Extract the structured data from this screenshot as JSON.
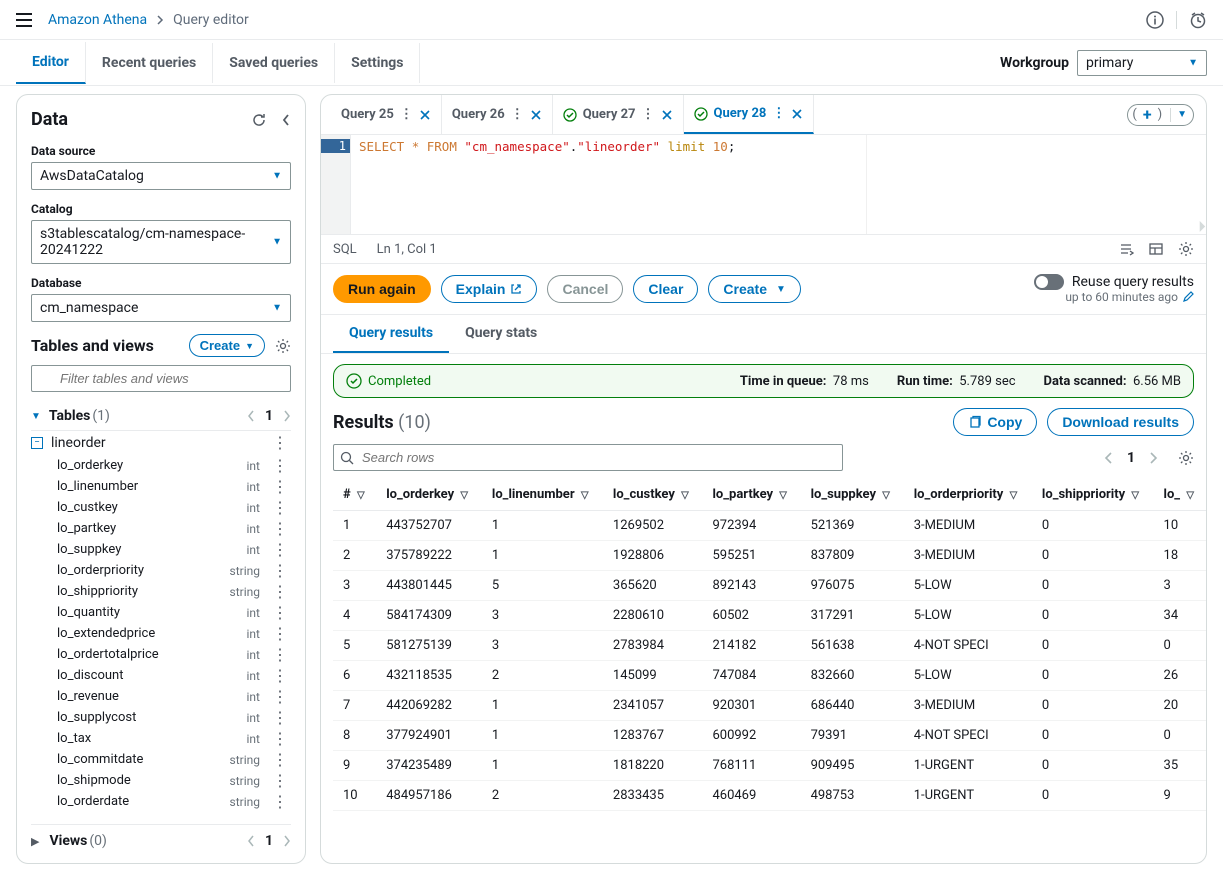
{
  "breadcrumb": {
    "service": "Amazon Athena",
    "page": "Query editor"
  },
  "topnav": {
    "tabs": [
      "Editor",
      "Recent queries",
      "Saved queries",
      "Settings"
    ],
    "workgroup_label": "Workgroup",
    "workgroup_value": "primary"
  },
  "sidebar": {
    "title": "Data",
    "data_source_label": "Data source",
    "data_source_value": "AwsDataCatalog",
    "catalog_label": "Catalog",
    "catalog_value": "s3tablescatalog/cm-namespace-20241222",
    "database_label": "Database",
    "database_value": "cm_namespace",
    "tables_views_label": "Tables and views",
    "create_label": "Create",
    "filter_placeholder": "Filter tables and views",
    "tables_label": "Tables",
    "tables_count": "(1)",
    "page": "1",
    "table_name": "lineorder",
    "columns": [
      {
        "name": "lo_orderkey",
        "type": "int"
      },
      {
        "name": "lo_linenumber",
        "type": "int"
      },
      {
        "name": "lo_custkey",
        "type": "int"
      },
      {
        "name": "lo_partkey",
        "type": "int"
      },
      {
        "name": "lo_suppkey",
        "type": "int"
      },
      {
        "name": "lo_orderpriority",
        "type": "string"
      },
      {
        "name": "lo_shippriority",
        "type": "string"
      },
      {
        "name": "lo_quantity",
        "type": "int"
      },
      {
        "name": "lo_extendedprice",
        "type": "int"
      },
      {
        "name": "lo_ordertotalprice",
        "type": "int"
      },
      {
        "name": "lo_discount",
        "type": "int"
      },
      {
        "name": "lo_revenue",
        "type": "int"
      },
      {
        "name": "lo_supplycost",
        "type": "int"
      },
      {
        "name": "lo_tax",
        "type": "int"
      },
      {
        "name": "lo_commitdate",
        "type": "string"
      },
      {
        "name": "lo_shipmode",
        "type": "string"
      },
      {
        "name": "lo_orderdate",
        "type": "string"
      }
    ],
    "views_label": "Views",
    "views_count": "(0)",
    "views_page": "1"
  },
  "query_tabs": [
    {
      "label": "Query 25",
      "completed": false,
      "active": false
    },
    {
      "label": "Query 26",
      "completed": false,
      "active": false
    },
    {
      "label": "Query 27",
      "completed": true,
      "active": false
    },
    {
      "label": "Query 28",
      "completed": true,
      "active": true
    }
  ],
  "editor": {
    "line_number": "1",
    "sql_select": "SELECT",
    "sql_star": "*",
    "sql_from": "FROM",
    "sql_ns": "\"cm_namespace\"",
    "sql_dot": ".",
    "sql_tbl": "\"lineorder\"",
    "sql_limit": "limit",
    "sql_num": "10",
    "sql_semi": ";",
    "footer_lang": "SQL",
    "footer_pos": "Ln 1, Col 1"
  },
  "actions": {
    "run": "Run again",
    "explain": "Explain",
    "cancel": "Cancel",
    "clear": "Clear",
    "create": "Create",
    "reuse_label": "Reuse query results",
    "reuse_note": "up to 60 minutes ago"
  },
  "results_tabs": {
    "results": "Query results",
    "stats": "Query stats"
  },
  "status": {
    "state": "Completed",
    "queue_label": "Time in queue:",
    "queue_value": "78 ms",
    "runtime_label": "Run time:",
    "runtime_value": "5.789 sec",
    "scanned_label": "Data scanned:",
    "scanned_value": "6.56 MB"
  },
  "results": {
    "title": "Results",
    "count": "(10)",
    "copy": "Copy",
    "download": "Download results",
    "search_placeholder": "Search rows",
    "page": "1",
    "headers": [
      "#",
      "lo_orderkey",
      "lo_linenumber",
      "lo_custkey",
      "lo_partkey",
      "lo_suppkey",
      "lo_orderpriority",
      "lo_shippriority",
      "lo_"
    ],
    "rows": [
      [
        "1",
        "443752707",
        "1",
        "1269502",
        "972394",
        "521369",
        "3-MEDIUM",
        "0",
        "10"
      ],
      [
        "2",
        "375789222",
        "1",
        "1928806",
        "595251",
        "837809",
        "3-MEDIUM",
        "0",
        "18"
      ],
      [
        "3",
        "443801445",
        "5",
        "365620",
        "892143",
        "976075",
        "5-LOW",
        "0",
        "3"
      ],
      [
        "4",
        "584174309",
        "3",
        "2280610",
        "60502",
        "317291",
        "5-LOW",
        "0",
        "34"
      ],
      [
        "5",
        "581275139",
        "3",
        "2783984",
        "214182",
        "561638",
        "4-NOT SPECI",
        "0",
        "0"
      ],
      [
        "6",
        "432118535",
        "2",
        "145099",
        "747084",
        "832660",
        "5-LOW",
        "0",
        "26"
      ],
      [
        "7",
        "442069282",
        "1",
        "2341057",
        "920301",
        "686440",
        "3-MEDIUM",
        "0",
        "20"
      ],
      [
        "8",
        "377924901",
        "1",
        "1283767",
        "600992",
        "79391",
        "4-NOT SPECI",
        "0",
        "0"
      ],
      [
        "9",
        "374235489",
        "1",
        "1818220",
        "768111",
        "909495",
        "1-URGENT",
        "0",
        "35"
      ],
      [
        "10",
        "484957186",
        "2",
        "2833435",
        "460469",
        "498753",
        "1-URGENT",
        "0",
        "9"
      ]
    ]
  }
}
